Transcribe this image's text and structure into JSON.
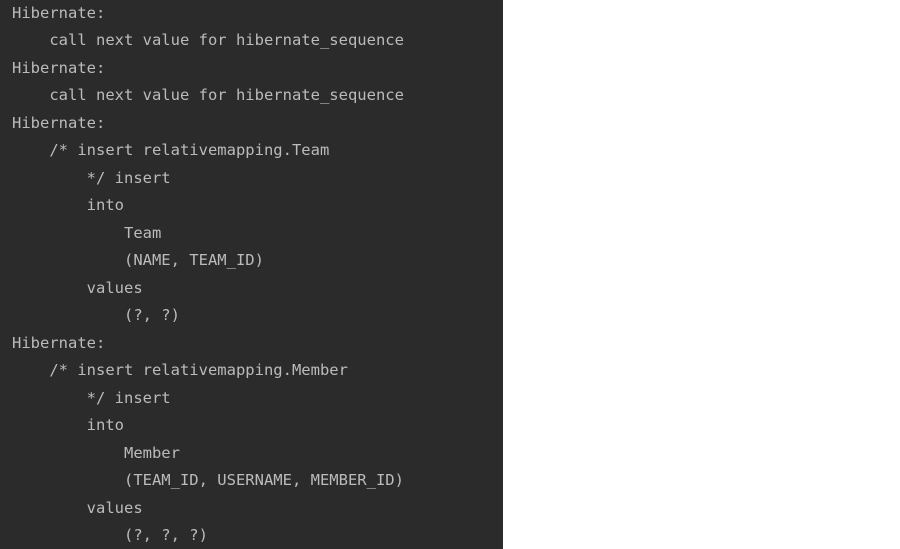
{
  "console": {
    "lines": [
      "Hibernate: ",
      "    call next value for hibernate_sequence",
      "Hibernate: ",
      "    call next value for hibernate_sequence",
      "Hibernate: ",
      "    /* insert relativemapping.Team",
      "        */ insert ",
      "        into",
      "            Team",
      "            (NAME, TEAM_ID) ",
      "        values",
      "            (?, ?)",
      "Hibernate: ",
      "    /* insert relativemapping.Member",
      "        */ insert ",
      "        into",
      "            Member",
      "            (TEAM_ID, USERNAME, MEMBER_ID) ",
      "        values",
      "            (?, ?, ?)"
    ],
    "background_color": "#2b2b2b",
    "text_color": "#bbbbbb"
  }
}
